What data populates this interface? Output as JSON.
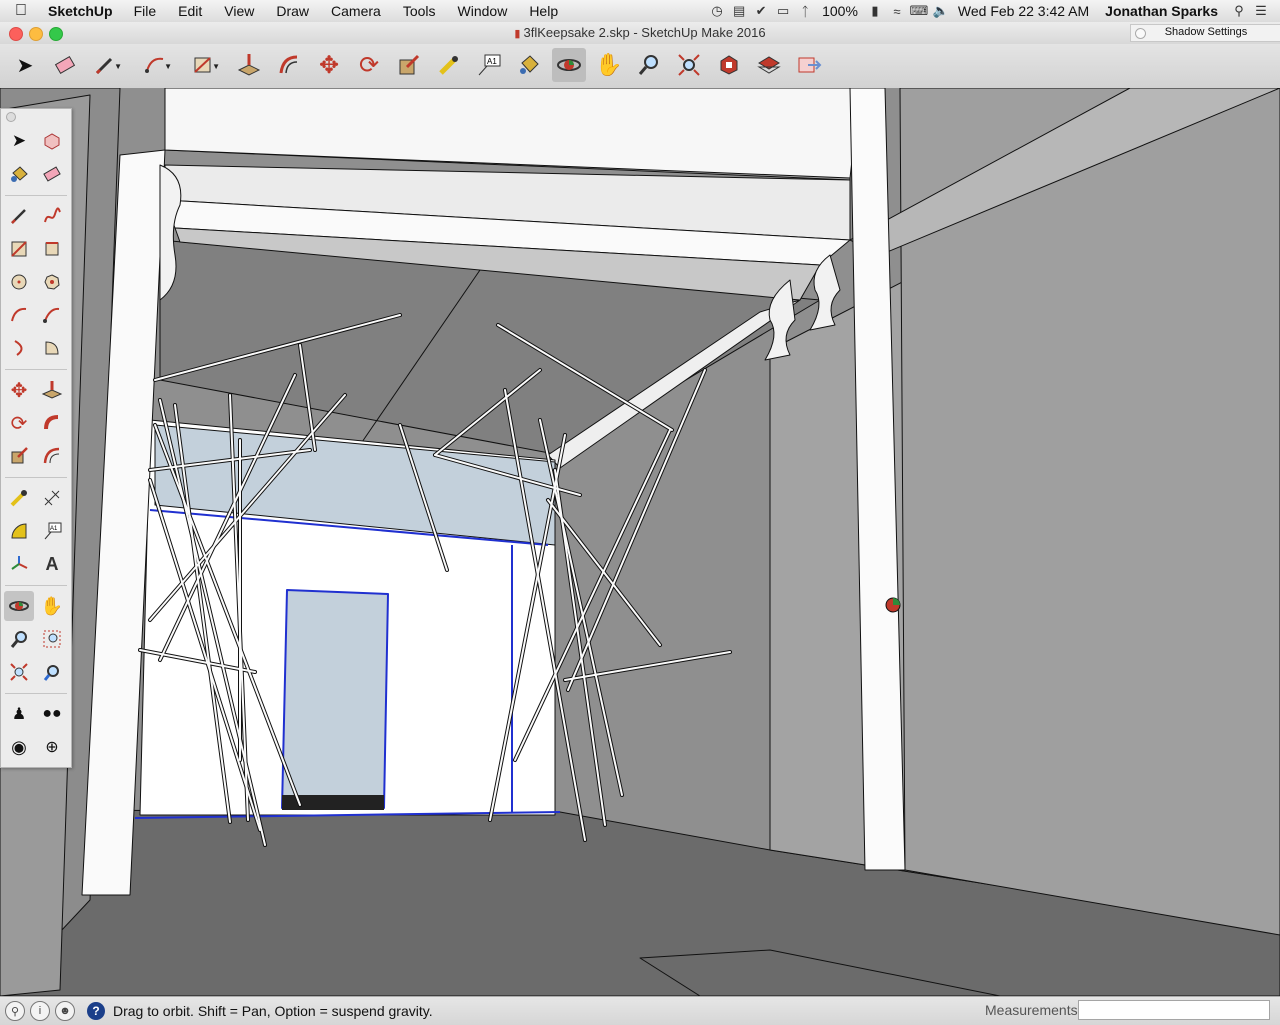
{
  "menubar": {
    "app_name": "SketchUp",
    "menus": [
      "File",
      "Edit",
      "View",
      "Draw",
      "Camera",
      "Tools",
      "Window",
      "Help"
    ],
    "battery": "100%",
    "clock": "Wed Feb 22  3:42 AM",
    "user": "Jonathan Sparks"
  },
  "window": {
    "title": "3flKeepsake 2.skp - SketchUp Make 2016",
    "shadow_panel": "Shadow Settings"
  },
  "toolbar": {
    "tools": [
      "select",
      "eraser",
      "pencil",
      "arc",
      "shapes",
      "push-pull",
      "offset",
      "move",
      "rotate",
      "scale",
      "tape-measure",
      "text",
      "paint-bucket",
      "orbit",
      "pan",
      "zoom",
      "zoom-extents",
      "warehouse",
      "extension-warehouse",
      "send-to-layout"
    ],
    "active": "orbit"
  },
  "palette": {
    "tools": [
      "select",
      "make-component",
      "paint-bucket",
      "eraser",
      "line",
      "freehand",
      "rectangle",
      "rotated-rectangle",
      "circle",
      "polygon",
      "arc",
      "2pt-arc",
      "3pt-arc",
      "pie",
      "move",
      "push-pull",
      "rotate",
      "follow-me",
      "scale",
      "offset",
      "tape-measure",
      "dimension",
      "protractor",
      "text",
      "axes",
      "3d-text",
      "orbit",
      "pan",
      "zoom",
      "zoom-window",
      "zoom-extents",
      "previous",
      "position-camera",
      "walk",
      "look-around",
      "section-plane"
    ],
    "active": "orbit"
  },
  "statusbar": {
    "message": "Drag to orbit. Shift = Pan, Option = suspend gravity.",
    "measurements_label": "Measurements",
    "measurements_value": ""
  }
}
